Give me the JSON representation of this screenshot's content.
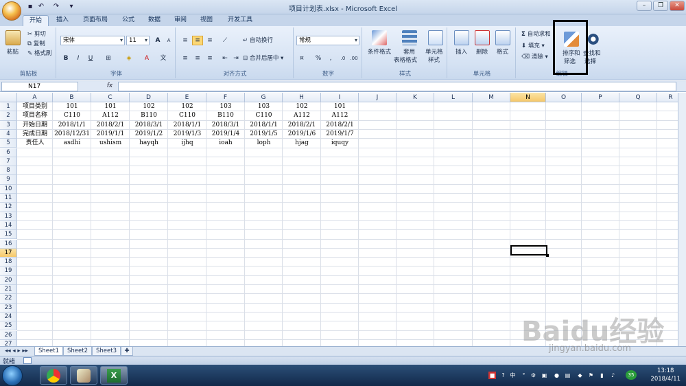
{
  "window": {
    "title": "项目计划表.xlsx - Microsoft Excel",
    "min_icon": "minimize-icon",
    "max_icon": "restore-icon",
    "close_icon": "close-icon"
  },
  "tabs": [
    "开始",
    "插入",
    "页面布局",
    "公式",
    "数据",
    "审阅",
    "视图",
    "开发工具"
  ],
  "ribbon": {
    "clipboard": {
      "caption": "剪贴板",
      "paste": "粘贴",
      "cut": "剪切",
      "copy": "复制",
      "format_painter": "格式刷"
    },
    "font": {
      "caption": "字体",
      "font_name": "宋体",
      "font_size": "11",
      "bold": "B",
      "italic": "I",
      "underline": "U",
      "grow": "A",
      "shrink": "A"
    },
    "alignment": {
      "caption": "对齐方式",
      "wrap": "自动换行",
      "merge": "合并后居中"
    },
    "number": {
      "caption": "数字",
      "format": "常规",
      "percent": "%",
      "comma": ","
    },
    "styles": {
      "caption": "样式",
      "conditional": "条件格式",
      "table_line1": "套用",
      "table_line2": "表格格式",
      "cell_line1": "单元格",
      "cell_line2": "样式"
    },
    "cells": {
      "caption": "单元格",
      "insert": "插入",
      "delete": "删除",
      "format": "格式"
    },
    "editing": {
      "caption": "编辑",
      "autosum": "自动求和",
      "fill": "填充",
      "clear": "清除",
      "sort1": "排序和",
      "sort2": "筛选",
      "find1": "查找和",
      "find2": "选择"
    }
  },
  "formula_bar": {
    "name_box": "N17",
    "fx": "fx",
    "content": ""
  },
  "columns": [
    "A",
    "B",
    "C",
    "D",
    "E",
    "F",
    "G",
    "H",
    "I",
    "J",
    "K",
    "L",
    "M",
    "N",
    "O",
    "P",
    "Q",
    "R"
  ],
  "selected_column": "N",
  "selected_row": "17",
  "rows": [
    "1",
    "2",
    "3",
    "4",
    "5",
    "6",
    "7",
    "8",
    "9",
    "10",
    "11",
    "12",
    "13",
    "14",
    "15",
    "16",
    "17",
    "18",
    "19",
    "20",
    "21",
    "22",
    "23",
    "24",
    "25",
    "26",
    "27"
  ],
  "cells": [
    [
      "项目类别",
      "101",
      "101",
      "102",
      "102",
      "103",
      "103",
      "102",
      "101"
    ],
    [
      "项目名称",
      "C110",
      "A112",
      "B110",
      "C110",
      "B110",
      "C110",
      "A112",
      "A112"
    ],
    [
      "开始日期",
      "2018/1/1",
      "2018/2/1",
      "2018/3/1",
      "2018/1/1",
      "2018/3/1",
      "2018/1/1",
      "2018/2/1",
      "2018/2/1"
    ],
    [
      "完成日期",
      "2018/12/31",
      "2019/1/1",
      "2019/1/2",
      "2019/1/3",
      "2019/1/4",
      "2019/1/5",
      "2019/1/6",
      "2019/1/7"
    ],
    [
      "责任人",
      "asdhi",
      "ushism",
      "hayqh",
      "ijhq",
      "ioah",
      "loph",
      "hjag",
      "iquqy"
    ]
  ],
  "sheets": [
    "Sheet1",
    "Sheet2",
    "Sheet3"
  ],
  "status": {
    "ready": "就绪"
  },
  "taskbar": {
    "time": "13:18",
    "date": "2018/4/11",
    "ime": "中",
    "badge": "35"
  },
  "watermark": {
    "text": "Baidu经验",
    "url": "jingyan.baidu.com"
  }
}
